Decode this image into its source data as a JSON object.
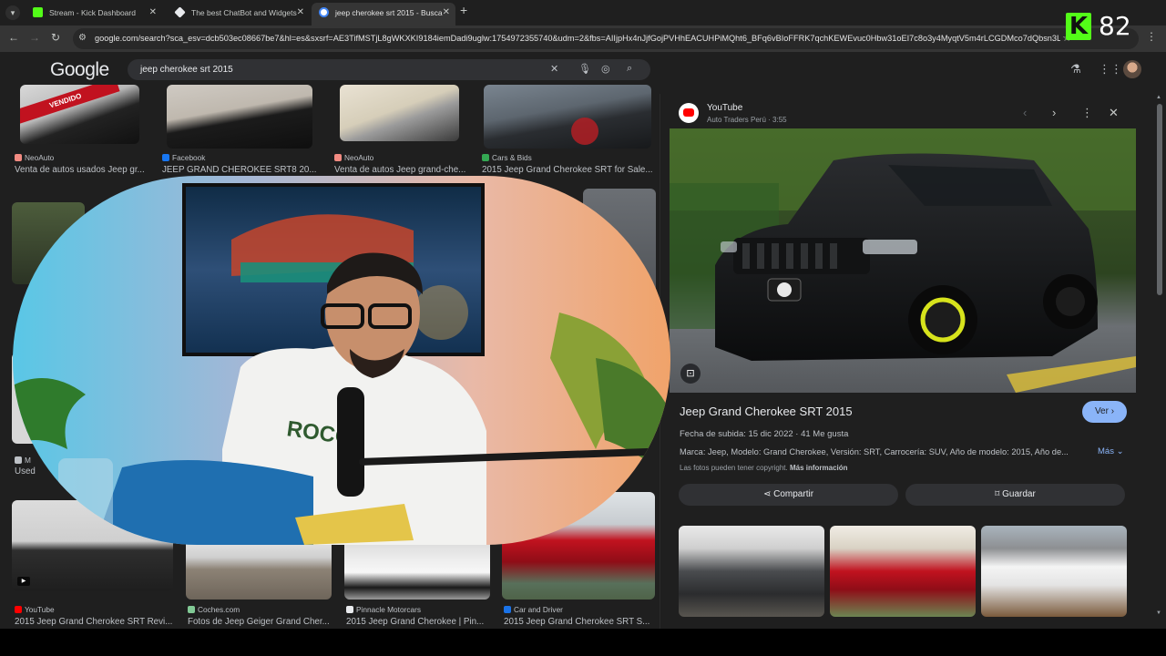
{
  "tabs": [
    {
      "title": "Stream - Kick Dashboard",
      "favicon_color": "#53fc18"
    },
    {
      "title": "The best ChatBot and Widgets",
      "favicon_color": "#e8eaed"
    },
    {
      "title": "jeep cherokee srt 2015 - Busca",
      "favicon_color": "#4285f4"
    }
  ],
  "address_bar": {
    "url": "google.com/search?sca_esv=dcb503ec08667be7&hl=es&sxsrf=AE3TifMSTjL8gWKXKI9184iemDadi9uglw:1754972355740&udm=2&fbs=AIIjpHx4nJjfGojPVHhEACUHPiMQht6_BFq6vBIoFFRK7qchKEWEvuc0Hbw31oEI7c8o3y4MyqtV5m4rLCGDMco7dQbsn3L..."
  },
  "kick": {
    "viewer_count": "82",
    "logo_letter": "K"
  },
  "google": {
    "logo": "Google",
    "query": "jeep cherokee srt 2015"
  },
  "results_row1": [
    {
      "source": "NeoAuto",
      "caption": "Venta de autos usados Jeep gr...",
      "fav": "#f28b82",
      "sticker": "VENDIDO"
    },
    {
      "source": "Facebook",
      "caption": "JEEP GRAND CHEROKEE SRT8 20...",
      "fav": "#1877f2"
    },
    {
      "source": "NeoAuto",
      "caption": "Venta de autos Jeep grand-che...",
      "fav": "#f28b82"
    },
    {
      "source": "Cars & Bids",
      "caption": "2015 Jeep Grand Cherokee SRT for Sale...",
      "fav": "#34a853"
    }
  ],
  "results_row2_partial": {
    "source": "M",
    "caption": "Used"
  },
  "results_row3": [
    {
      "source": "YouTube",
      "caption": "2015 Jeep Grand Cherokee SRT Revi...",
      "fav": "#ff0000"
    },
    {
      "source": "Coches.com",
      "caption": "Fotos de Jeep Geiger Grand Cher...",
      "fav": "#81c995"
    },
    {
      "source": "Pinnacle Motorcars",
      "caption": "2015 Jeep Grand Cherokee | Pin...",
      "fav": "#e8eaed"
    },
    {
      "source": "Car and Driver",
      "caption": "2015 Jeep Grand Cherokee SRT S...",
      "fav": "#1a73e8"
    }
  ],
  "panel": {
    "source": "YouTube",
    "subtitle": "Auto Traders Perú · 3:55",
    "title": "Jeep Grand Cherokee SRT 2015",
    "view_button": "Ver",
    "meta": "Fecha de subida: 15 dic 2022 · 41 Me gusta",
    "description": "Marca: Jeep, Modelo: Grand Cherokee, Versión: SRT, Carrocería: SUV, Año de modelo: 2015, Año de...",
    "more": "Más",
    "copyright": "Las fotos pueden tener copyright.",
    "more_info": "Más información",
    "share": "Compartir",
    "save": "Guardar"
  }
}
